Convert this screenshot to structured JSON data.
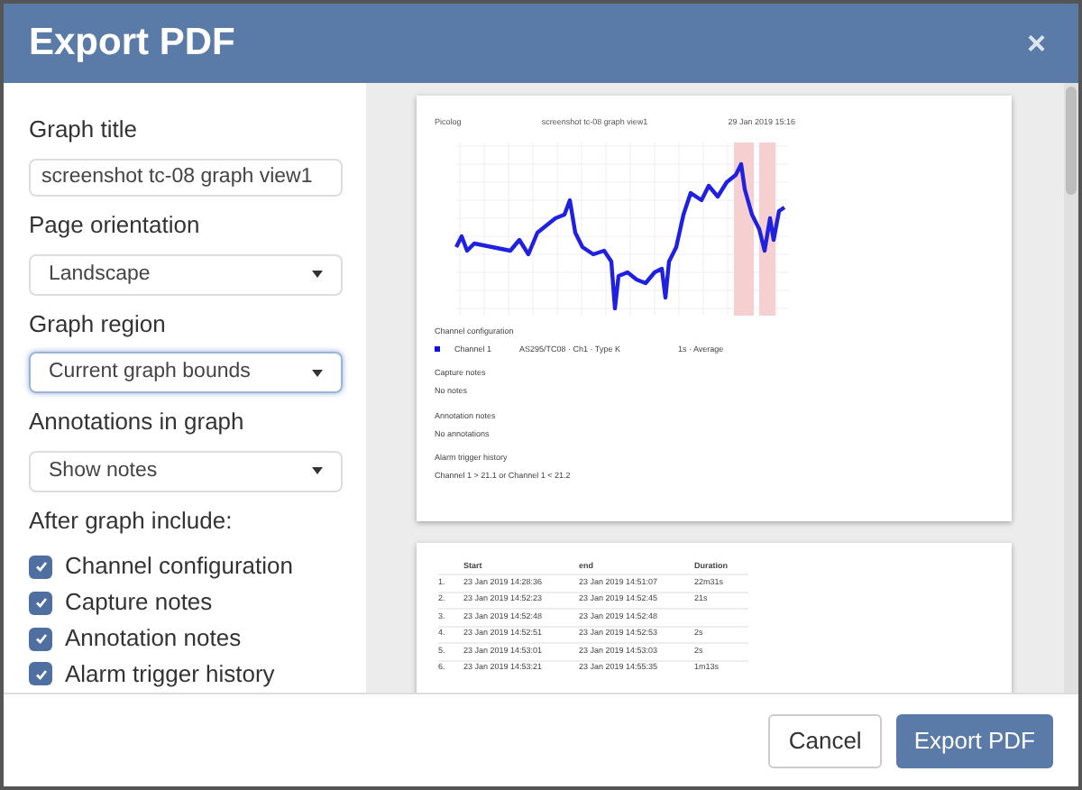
{
  "window": {
    "title": "Export PDF",
    "close": "×"
  },
  "form": {
    "graph_title": {
      "label": "Graph title",
      "value": "screenshot tc-08 graph view1"
    },
    "page_orientation": {
      "label": "Page orientation",
      "value": "Landscape",
      "focused": false
    },
    "graph_region": {
      "label": "Graph region",
      "value": "Current graph bounds",
      "focused": true
    },
    "annotations": {
      "label": "Annotations in graph",
      "value": "Show notes",
      "focused": false
    },
    "after_graph_label": "After graph include:",
    "includes": [
      {
        "label": "Channel configuration",
        "checked": true
      },
      {
        "label": "Capture notes",
        "checked": true
      },
      {
        "label": "Annotation notes",
        "checked": true
      },
      {
        "label": "Alarm trigger history",
        "checked": true
      }
    ]
  },
  "preview": {
    "page_1": {
      "app": "Picolog",
      "title": "screenshot tc-08 graph view1",
      "date": "29 Jan 2019 15:16",
      "sections": [
        {
          "kind": "channel",
          "heading": "Channel configuration",
          "channel": "Channel 1",
          "color": "#1010e0",
          "device": "AS295/TC08 · Ch1 · Type K",
          "sampling": "1s · Average"
        },
        {
          "kind": "text",
          "heading": "Capture notes",
          "text": "No notes"
        },
        {
          "kind": "text",
          "heading": "Annotation notes",
          "text": "No annotations"
        },
        {
          "kind": "text",
          "heading": "Alarm trigger history",
          "text": "Channel 1 > 21.1 or Channel 1 < 21.2"
        }
      ]
    },
    "page_2": {
      "columns": [
        "Start",
        "end",
        "Duration"
      ],
      "rows": [
        {
          "index": "1.",
          "start": "23 Jan 2019 14:28:36",
          "end": "23 Jan 2019 14:51:07",
          "duration": "22m31s"
        },
        {
          "index": "2.",
          "start": "23 Jan 2019 14:52:23",
          "end": "23 Jan 2019 14:52:45",
          "duration": "21s"
        },
        {
          "index": "3.",
          "start": "23 Jan 2019 14:52:48",
          "end": "23 Jan 2019 14:52:48"
        },
        {
          "index": "4.",
          "start": "23 Jan 2019 14:52:51",
          "end": "23 Jan 2019 14:52:53",
          "duration": "2s"
        },
        {
          "index": "5.",
          "start": "23 Jan 2019 14:53:01",
          "end": "23 Jan 2019 14:53:03",
          "duration": "2s"
        },
        {
          "index": "6.",
          "start": "23 Jan 2019 14:53:21",
          "end": "23 Jan 2019 14:55:35",
          "duration": "1m13s"
        }
      ]
    }
  },
  "buttons": [
    {
      "label": "Cancel",
      "kind": "secondary"
    },
    {
      "label": "Export PDF",
      "kind": "primary"
    }
  ]
}
